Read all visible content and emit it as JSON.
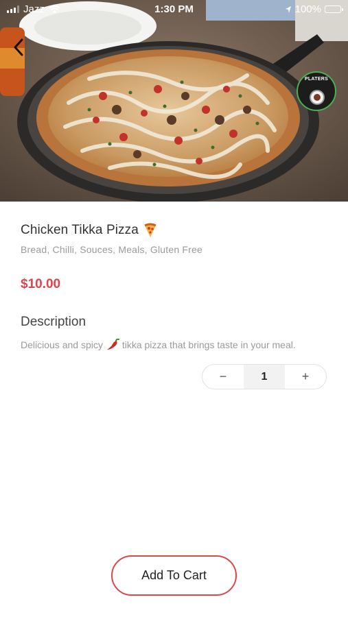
{
  "status_bar": {
    "carrier": "Jazz",
    "time": "1:30 PM",
    "battery": "100%",
    "battery_color": "#4cd964"
  },
  "navigation": {
    "back_icon": "chevron-left-icon"
  },
  "restaurant_badge": {
    "logo_text": "PLATERS",
    "ring_color": "#4caf50"
  },
  "product": {
    "title": "Chicken Tikka Pizza",
    "title_icon": "pizza-slice-icon",
    "tags": "Bread, Chilli, Souces, Meals, Gluten Free",
    "price": "$10.00",
    "price_color": "#d9464b"
  },
  "description": {
    "heading": "Description",
    "text_before": "Delicious and spicy",
    "inline_icon": "chilli-pepper-icon",
    "text_after": "tikka pizza that brings taste in your meal."
  },
  "quantity": {
    "decrement_label": "−",
    "value": "1",
    "increment_label": "+"
  },
  "actions": {
    "add_to_cart_label": "Add To Cart",
    "accent_color": "#d9464b"
  }
}
